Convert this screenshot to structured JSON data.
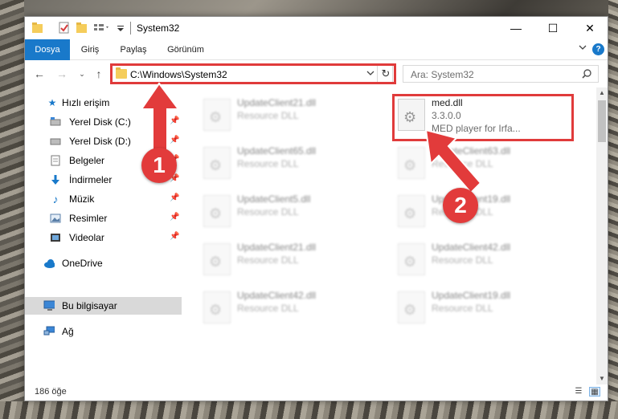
{
  "window": {
    "title": "System32",
    "controls": {
      "minimize": "—",
      "maximize": "☐",
      "close": "✕"
    }
  },
  "ribbon": {
    "tabs": [
      {
        "label": "Dosya",
        "active": true
      },
      {
        "label": "Giriş"
      },
      {
        "label": "Paylaş"
      },
      {
        "label": "Görünüm"
      }
    ],
    "help": "?"
  },
  "address": {
    "path": "C:\\Windows\\System32",
    "search_placeholder": "Ara: System32"
  },
  "nav": {
    "quick_access": "Hızlı erişim",
    "items": [
      {
        "label": "Yerel Disk (C:)",
        "icon": "drive-icon",
        "pinned": true
      },
      {
        "label": "Yerel Disk (D:)",
        "icon": "drive-icon",
        "pinned": true
      },
      {
        "label": "Belgeler",
        "icon": "documents-icon",
        "pinned": true
      },
      {
        "label": "İndirmeler",
        "icon": "download-icon",
        "pinned": true
      },
      {
        "label": "Müzik",
        "icon": "music-icon",
        "pinned": true
      },
      {
        "label": "Resimler",
        "icon": "pictures-icon",
        "pinned": true
      },
      {
        "label": "Videolar",
        "icon": "videos-icon",
        "pinned": true
      }
    ],
    "onedrive": "OneDrive",
    "this_pc": "Bu bilgisayar",
    "network": "Ağ"
  },
  "files": {
    "highlighted": {
      "name": "med.dll",
      "version": "3.3.0.0",
      "description": "MED player for Irfa..."
    },
    "left_column": [
      {
        "name": "UpdateClient21.dll",
        "type": "Resource DLL"
      },
      {
        "name": "UpdateClient65.dll",
        "type": "Resource DLL"
      },
      {
        "name": "UpdateClient5.dll",
        "type": "Resource DLL"
      },
      {
        "name": "UpdateClient21.dll",
        "type": "Resource DLL"
      },
      {
        "name": "UpdateClient42.dll",
        "type": "Resource DLL"
      }
    ],
    "right_column": [
      {
        "name": "UpdateClient63.dll",
        "type": "Resource DLL"
      },
      {
        "name": "UpdateClient19.dll",
        "type": "Resource DLL"
      },
      {
        "name": "UpdateClient42.dll",
        "type": "Resource DLL"
      },
      {
        "name": "UpdateClient19.dll",
        "type": "Resource DLL"
      }
    ]
  },
  "status": {
    "item_count": "186 öğe"
  },
  "annotations": {
    "step1": "1",
    "step2": "2",
    "color": "#e23b3b"
  }
}
